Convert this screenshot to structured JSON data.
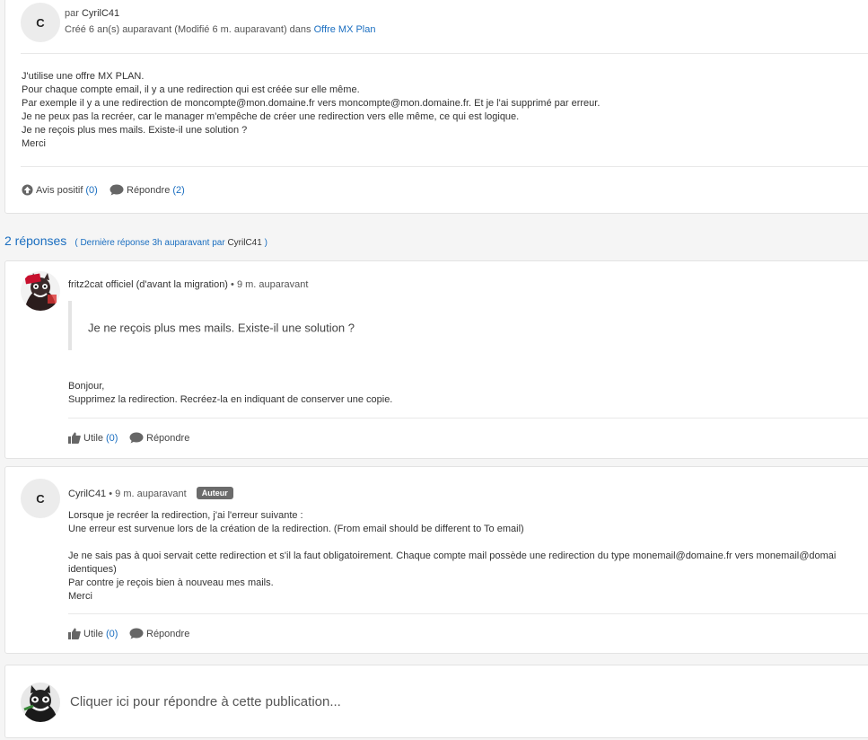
{
  "post": {
    "avatar_letter": "C",
    "by_prefix": "par",
    "author": "CyrilC41",
    "created": "Créé 6 an(s) auparavant (Modifié 6 m. auparavant) dans",
    "forum": "Offre MX Plan",
    "body": "J'utilise une offre MX PLAN.\nPour chaque compte email, il y a une redirection qui est créée sur elle même.\nPar exemple il y a une redirection de moncompte@mon.domaine.fr vers moncompte@mon.domaine.fr. Et je l'ai supprimé par erreur.\nJe ne peux pas la recréer, car le manager m'empêche de créer une redirection vers elle même, ce qui est logique.\nJe ne reçois plus mes mails. Existe-il une solution ?\nMerci",
    "actions": {
      "avis_label": "Avis positif",
      "avis_count": "(0)",
      "reply_label": "Répondre",
      "reply_count": "(2)"
    }
  },
  "replies_header": {
    "count": "2 réponses",
    "last_prefix": "( Dernière réponse 3h auparavant par",
    "last_author": "CyrilC41",
    "last_suffix": ")"
  },
  "replies": [
    {
      "author": "fritz2cat officiel (d'avant la migration)",
      "time": " • 9 m. auparavant",
      "quote": "Je ne reçois plus mes mails. Existe-il une solution ?",
      "body": "Bonjour,\nSupprimez la redirection. Recréez-la en indiquant de conserver une copie.",
      "useful_label": "Utile",
      "useful_count": "(0)",
      "reply_label": "Répondre"
    },
    {
      "avatar_letter": "C",
      "author": "CyrilC41",
      "time": " • 9 m. auparavant",
      "badge": "Auteur",
      "body": "Lorsque je recréer la redirection, j'ai l'erreur suivante :\nUne erreur est survenue lors de la création de la redirection. (From email should be different to To email)\n\nJe ne sais pas à quoi servait cette redirection et s'il la faut obligatoirement. Chaque compte mail possède une redirection du type monemail@domaine.fr vers monemail@domai\nidentiques)\nPar contre je reçois bien à nouveau mes mails.\nMerci",
      "useful_label": "Utile",
      "useful_count": "(0)",
      "reply_label": "Répondre"
    }
  ],
  "reply_box": {
    "placeholder": "Cliquer ici pour répondre à cette publication..."
  },
  "colors": {
    "link": "#1a6ec0",
    "badge": "#6b6b6b"
  }
}
